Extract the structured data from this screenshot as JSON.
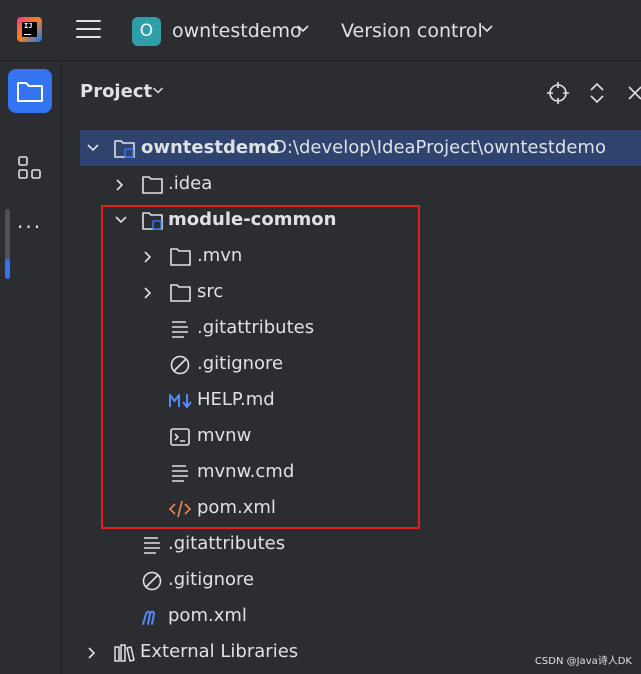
{
  "topbar": {
    "app_logo": "intellij-logo",
    "app_logo_text": "IJ",
    "menu_icon": "hamburger-menu-icon",
    "project_badge": "O",
    "project_name": "owntestdemo",
    "vcs_label": "Version control"
  },
  "toolstrip": {
    "items": [
      "project-tool-icon",
      "structure-tool-icon",
      "more-tools-icon"
    ],
    "more_label": "···"
  },
  "panel": {
    "title": "Project",
    "header_icons": [
      "locate-icon",
      "expand-collapse-icon",
      "close-icon"
    ]
  },
  "tree": {
    "root": {
      "name": "owntestdemo",
      "path": "D:\\develop\\IdeaProject\\owntestdemo",
      "expanded": true
    },
    "rows": [
      {
        "label": ".idea",
        "type": "folder",
        "expanded": false
      },
      {
        "label": "module-common",
        "type": "module-folder",
        "expanded": true
      },
      {
        "label": ".mvn",
        "type": "folder",
        "expanded": false
      },
      {
        "label": "src",
        "type": "folder",
        "expanded": false
      },
      {
        "label": ".gitattributes",
        "type": "text-file"
      },
      {
        "label": ".gitignore",
        "type": "ignore-file"
      },
      {
        "label": "HELP.md",
        "type": "markdown-file"
      },
      {
        "label": "mvnw",
        "type": "shell-file"
      },
      {
        "label": "mvnw.cmd",
        "type": "text-file"
      },
      {
        "label": "pom.xml",
        "type": "xml-file"
      },
      {
        "label": ".gitattributes",
        "type": "text-file"
      },
      {
        "label": ".gitignore",
        "type": "ignore-file"
      },
      {
        "label": "pom.xml",
        "type": "maven-file"
      },
      {
        "label": "External Libraries",
        "type": "libraries",
        "expanded": false
      }
    ]
  },
  "colors": {
    "background": "#2b2d30",
    "selection": "#2e436e",
    "accent": "#3574f0",
    "highlight_box": "#e02020",
    "project_badge": "#2e9fa8"
  },
  "watermark": "CSDN @Java诗人DK"
}
